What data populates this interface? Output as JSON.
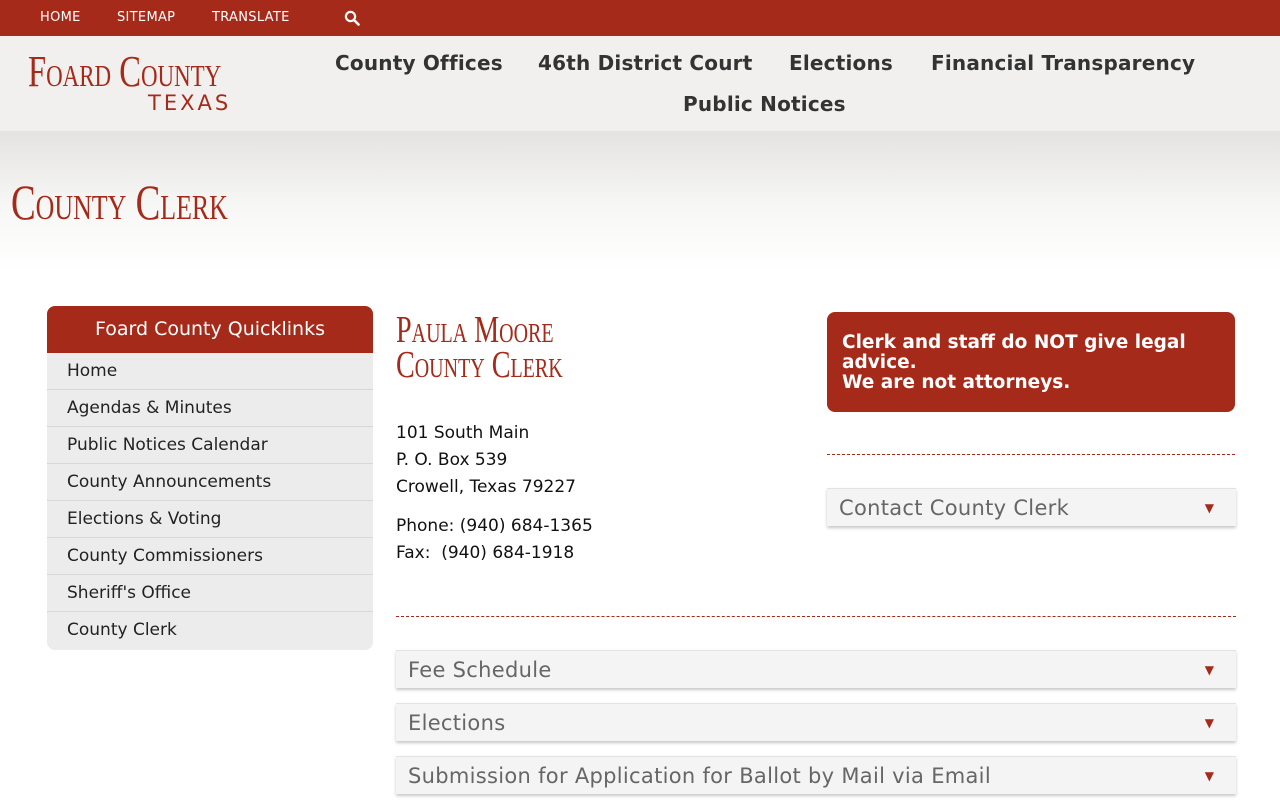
{
  "topbar": {
    "links": [
      "HOME",
      "SITEMAP",
      "TRANSLATE"
    ],
    "search_icon": "search-icon"
  },
  "logo": {
    "line1": "Foard County",
    "line2": "TEXAS"
  },
  "nav": {
    "items": [
      "County Offices",
      "46th District Court",
      "Elections",
      "Financial Transparency",
      "Public Notices"
    ]
  },
  "page": {
    "title": "County Clerk"
  },
  "quicklinks": {
    "title": "Foard County Quicklinks",
    "items": [
      "Home",
      "Agendas & Minutes",
      "Public Notices Calendar",
      "County Announcements",
      "Elections & Voting",
      "County Commissioners",
      "Sheriff's Office",
      "County Clerk"
    ]
  },
  "clerk": {
    "name": "Paula Moore",
    "title": "County Clerk",
    "address_line1": "101 South Main",
    "address_line2": "P. O. Box 539",
    "address_line3": "Crowell, Texas 79227",
    "phone": "Phone: (940) 684-1365",
    "fax": "Fax:  (940) 684-1918"
  },
  "notice": {
    "line1": "Clerk and staff do NOT give legal advice.",
    "line2": "We are not attorneys."
  },
  "accordions": {
    "contact": "Contact County Clerk",
    "fee_schedule": "Fee Schedule",
    "elections": "Elections",
    "ballot_by_mail": "Submission for Application for Ballot by Mail via Email",
    "arrow": "▼"
  },
  "colors": {
    "brand": "#a52a1a",
    "header_bg": "#f1f0ee",
    "quicklinks_bg": "#ececec"
  }
}
